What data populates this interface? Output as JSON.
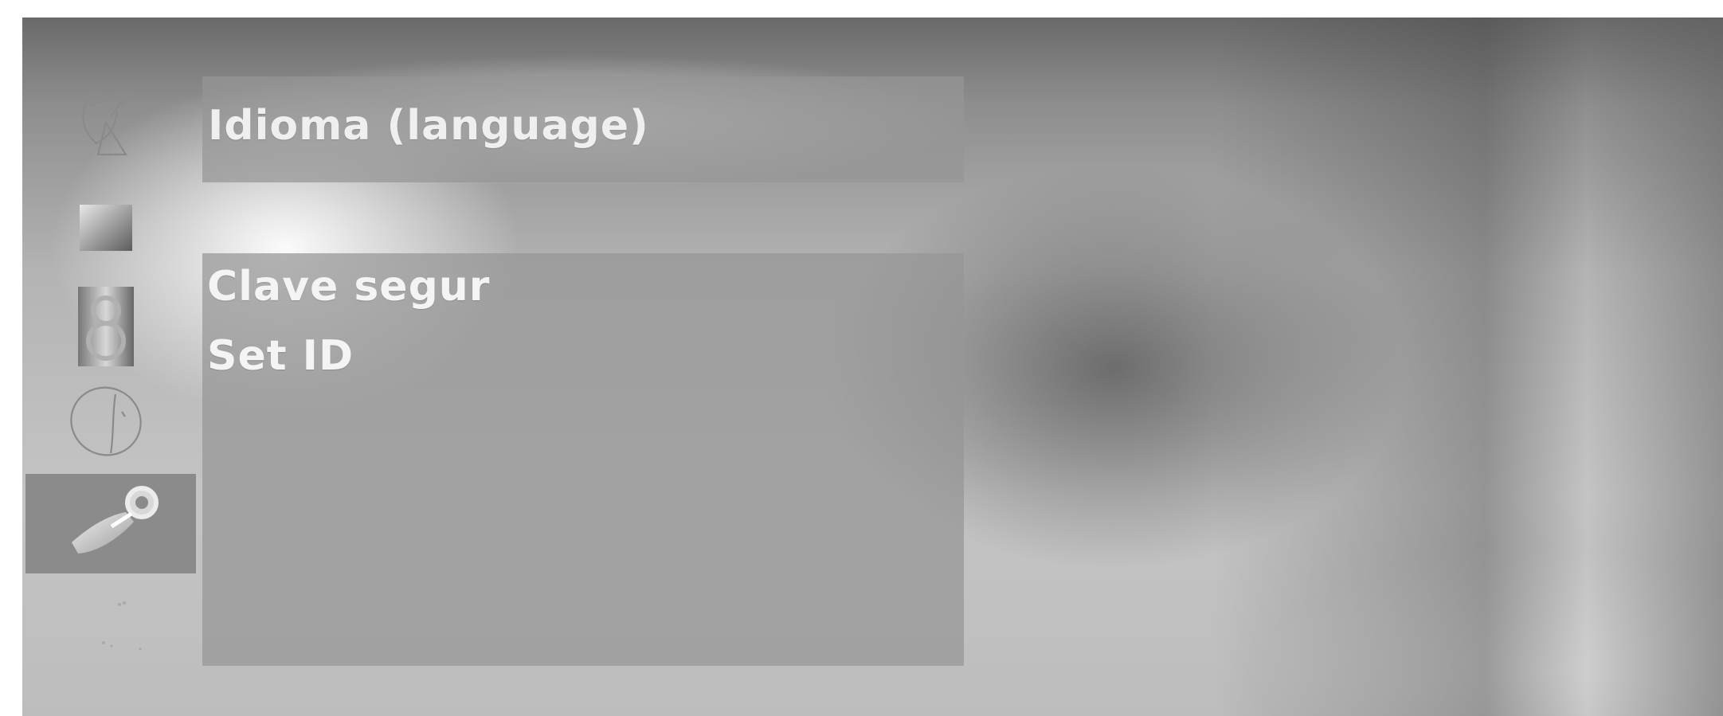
{
  "menu": {
    "title": "Idioma (language)",
    "options": [
      {
        "label": "Clave segur"
      },
      {
        "label": "Set ID"
      }
    ]
  },
  "sidebar": {
    "icons": [
      {
        "name": "antenna-icon"
      },
      {
        "name": "picture-icon"
      },
      {
        "name": "clock-icon"
      },
      {
        "name": "globe-icon"
      },
      {
        "name": "tools-icon",
        "selected": true
      }
    ]
  },
  "colors": {
    "panel": "#969696",
    "text": "#f4f4f4",
    "selected": "#787878"
  }
}
